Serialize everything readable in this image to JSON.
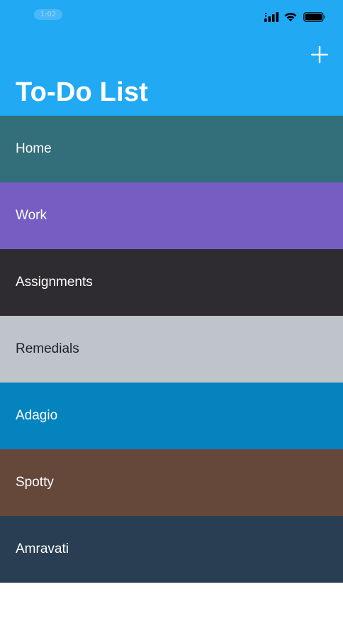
{
  "status_bar": {
    "time": "1:02"
  },
  "header": {
    "title": "To-Do List",
    "add_icon": "plus-icon",
    "background": "#22a9f4"
  },
  "categories": [
    {
      "label": "Home",
      "color": "#336e7b"
    },
    {
      "label": "Work",
      "color": "#765dc1"
    },
    {
      "label": "Assignments",
      "color": "#2e2c30"
    },
    {
      "label": "Remedials",
      "color": "#bfc3ca"
    },
    {
      "label": "Adagio",
      "color": "#0583bf"
    },
    {
      "label": "Spotty",
      "color": "#66483a"
    },
    {
      "label": "Amravati",
      "color": "#293e53"
    }
  ]
}
